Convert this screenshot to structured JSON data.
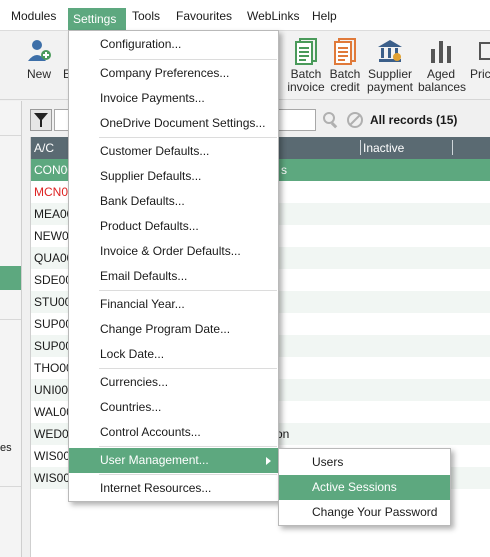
{
  "menubar": {
    "items": [
      "Modules",
      "Settings",
      "Tools",
      "Favourites",
      "WebLinks",
      "Help"
    ],
    "active": "Settings"
  },
  "toolbar": {
    "new_label": "New",
    "e_label": "E",
    "batch_invoice": [
      "Batch",
      "invoice"
    ],
    "batch_credit": [
      "Batch",
      "credit"
    ],
    "supplier_payment": [
      "Supplier",
      "payment"
    ],
    "aged_balances": [
      "Aged",
      "balances"
    ],
    "pric": "Pric"
  },
  "filter": {
    "records_label": "All records (15)"
  },
  "grid": {
    "columns": [
      "A/C",
      "Inactive"
    ],
    "rows": [
      "CON00",
      "MCN00",
      "MEA00",
      "NEW00",
      "QUA00",
      "SDE00",
      "STU00",
      "SUP00",
      "SUP00",
      "THO00",
      "UNI00",
      "WAL00",
      "WED00",
      "WIS00",
      "WIS00"
    ],
    "row_fragments": {
      "con_tail": "s",
      "wed_tail": "on"
    },
    "leftnav_text": "es"
  },
  "settings_menu": {
    "items": [
      "Configuration...",
      "Company Preferences...",
      "Invoice Payments...",
      "OneDrive Document Settings...",
      "Customer Defaults...",
      "Supplier Defaults...",
      "Bank Defaults...",
      "Product Defaults...",
      "Invoice & Order Defaults...",
      "Email Defaults...",
      "Financial Year...",
      "Change Program Date...",
      "Lock Date...",
      "Currencies...",
      "Countries...",
      "Control Accounts...",
      "User Management...",
      "Internet Resources..."
    ],
    "highlighted": "User Management..."
  },
  "user_management_submenu": {
    "items": [
      "Users",
      "Active Sessions",
      "Change Your Password"
    ],
    "highlighted": "Active Sessions"
  },
  "colors": {
    "accent": "#5da87f",
    "grid_header": "#5a6a72",
    "batch_icon_green": "#4a9a5a",
    "batch_icon_orange": "#e07a3a",
    "supplier_icon": "#3b5f8a"
  },
  "icons": {
    "new": "add-user-icon",
    "batch_invoice": "batch-invoice-icon",
    "batch_credit": "batch-credit-icon",
    "supplier_payment": "bank-icon",
    "aged_balances": "bar-chart-icon",
    "filter": "filter-icon",
    "search": "search-icon",
    "clear": "clear-icon"
  }
}
